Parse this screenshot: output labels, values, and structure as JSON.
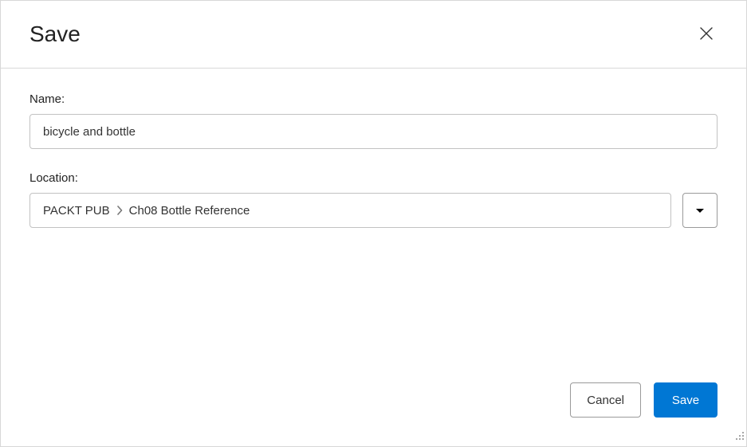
{
  "dialog": {
    "title": "Save",
    "name_label": "Name:",
    "name_value": "bicycle and bottle",
    "location_label": "Location:",
    "location_path": [
      "PACKT PUB",
      "Ch08 Bottle Reference"
    ],
    "cancel_label": "Cancel",
    "save_label": "Save"
  }
}
